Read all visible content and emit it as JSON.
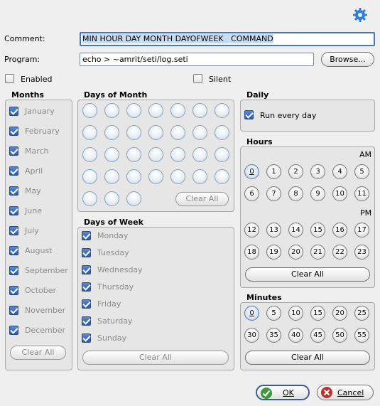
{
  "comment": {
    "label": "Comment:",
    "value": "MIN HOUR DAY MONTH DAYOFWEEK   COMMAND"
  },
  "program": {
    "label": "Program:",
    "value": "echo > ~amrit/seti/log.seti",
    "browse_label": "Browse..."
  },
  "enabled": {
    "label": "Enabled",
    "checked": false
  },
  "silent": {
    "label": "Silent",
    "checked": false
  },
  "months": {
    "title": "Months",
    "items": [
      "January",
      "February",
      "March",
      "April",
      "May",
      "June",
      "July",
      "August",
      "September",
      "October",
      "November",
      "December"
    ],
    "clear_label": "Clear All"
  },
  "days_of_month": {
    "title": "Days of Month",
    "count": 31,
    "clear_label": "Clear All"
  },
  "days_of_week": {
    "title": "Days of Week",
    "items": [
      "Monday",
      "Tuesday",
      "Wednesday",
      "Thursday",
      "Friday",
      "Saturday",
      "Sunday"
    ],
    "clear_label": "Clear All"
  },
  "daily": {
    "title": "Daily",
    "run_every_day_label": "Run every day",
    "checked": true
  },
  "hours": {
    "title": "Hours",
    "am_label": "AM",
    "pm_label": "PM",
    "am": [
      "0",
      "1",
      "2",
      "3",
      "4",
      "5",
      "6",
      "7",
      "8",
      "9",
      "10",
      "11"
    ],
    "pm": [
      "12",
      "13",
      "14",
      "15",
      "16",
      "17",
      "18",
      "19",
      "20",
      "21",
      "22",
      "23"
    ],
    "clear_label": "Clear All"
  },
  "minutes": {
    "title": "Minutes",
    "values": [
      "0",
      "5",
      "10",
      "15",
      "20",
      "25",
      "30",
      "35",
      "40",
      "45",
      "50",
      "55"
    ],
    "clear_label": "Clear All"
  },
  "footer": {
    "ok_label": "OK",
    "cancel_label": "Cancel"
  },
  "colors": {
    "accent": "#2c5aa8",
    "ok_border": "#3a5f95",
    "cancel_icon": "#c0302a",
    "ok_icon": "#3a9a3a"
  },
  "icons": {
    "settings": "gear-icon",
    "ok": "check-icon",
    "cancel": "cancel-x-icon"
  }
}
